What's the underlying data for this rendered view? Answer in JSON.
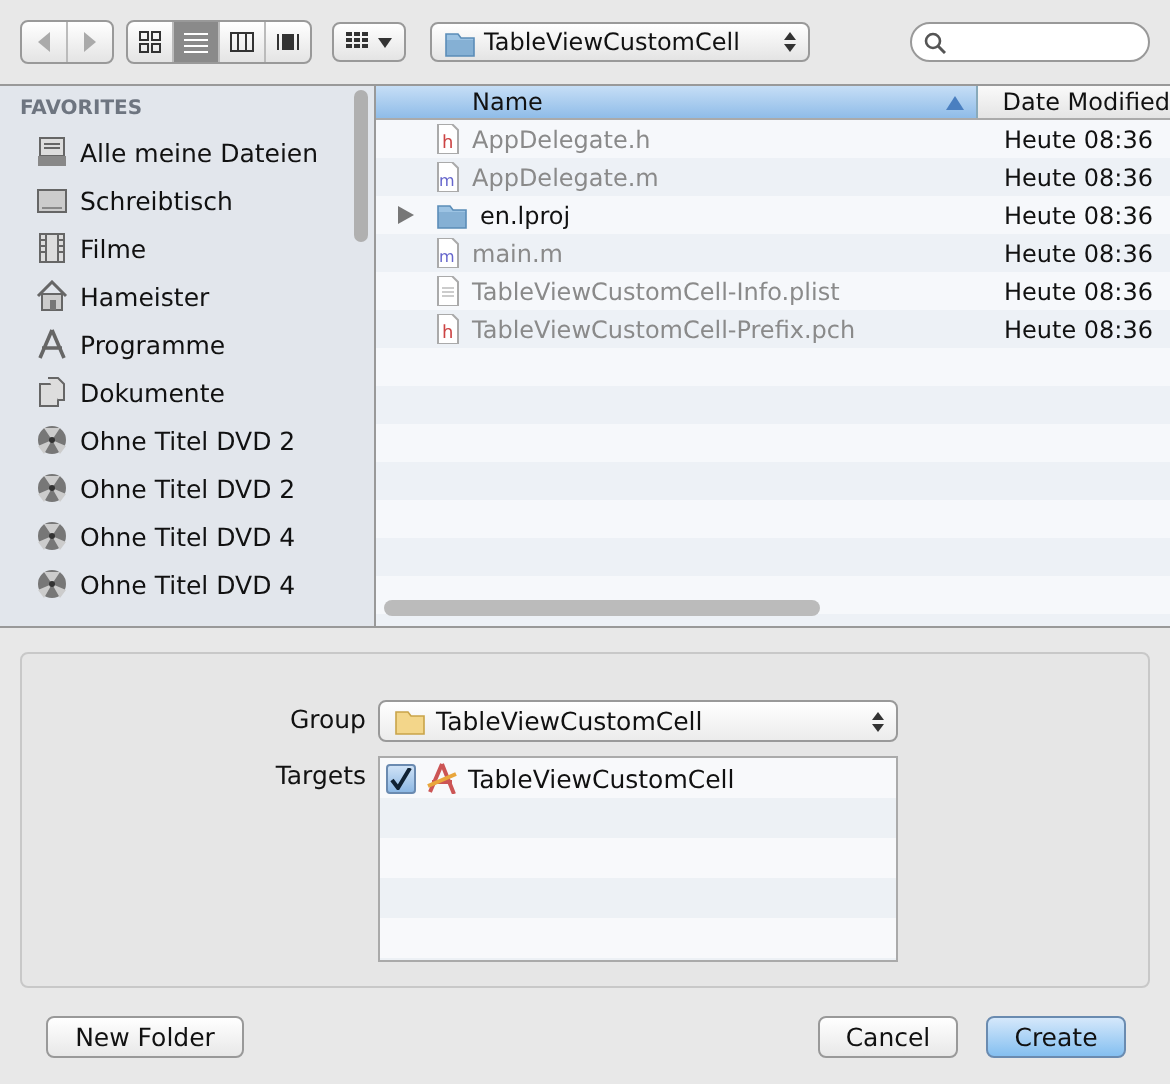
{
  "toolbar": {
    "view_modes": [
      {
        "kind": "icons",
        "selected": false
      },
      {
        "kind": "list",
        "selected": true
      },
      {
        "kind": "columns",
        "selected": false
      },
      {
        "kind": "coverflow",
        "selected": false
      }
    ],
    "location": "TableViewCustomCell"
  },
  "sidebar": {
    "heading": "FAVORITES",
    "items": [
      {
        "kind": "all",
        "label": "Alle meine Dateien"
      },
      {
        "kind": "desktop",
        "label": "Schreibtisch"
      },
      {
        "kind": "movies",
        "label": "Filme"
      },
      {
        "kind": "home",
        "label": "Hameister"
      },
      {
        "kind": "apps",
        "label": "Programme"
      },
      {
        "kind": "docs",
        "label": "Dokumente"
      },
      {
        "kind": "disc",
        "label": "Ohne Titel DVD 2"
      },
      {
        "kind": "disc",
        "label": "Ohne Titel DVD 2"
      },
      {
        "kind": "disc",
        "label": "Ohne Titel DVD 4"
      },
      {
        "kind": "disc",
        "label": "Ohne Titel DVD 4"
      }
    ]
  },
  "file_list": {
    "columns": [
      "Name",
      "Date Modified"
    ],
    "rows": [
      {
        "kind": "h",
        "name": "AppDelegate.h",
        "date": "Heute 08:36",
        "disabled": true
      },
      {
        "kind": "m",
        "name": "AppDelegate.m",
        "date": "Heute 08:36",
        "disabled": true
      },
      {
        "kind": "folder",
        "name": "en.lproj",
        "date": "Heute 08:36",
        "disabled": false,
        "expanded": false
      },
      {
        "kind": "m",
        "name": "main.m",
        "date": "Heute 08:36",
        "disabled": true
      },
      {
        "kind": "plist",
        "name": "TableViewCustomCell-Info.plist",
        "date": "Heute 08:36",
        "disabled": true
      },
      {
        "kind": "h",
        "name": "TableViewCustomCell-Prefix.pch",
        "date": "Heute 08:36",
        "disabled": true
      }
    ]
  },
  "options": {
    "group_label": "Group",
    "group_value": "TableViewCustomCell",
    "targets_label": "Targets",
    "targets": [
      {
        "name": "TableViewCustomCell",
        "checked": true
      }
    ]
  },
  "buttons": {
    "new_folder": "New Folder",
    "cancel": "Cancel",
    "create": "Create"
  }
}
